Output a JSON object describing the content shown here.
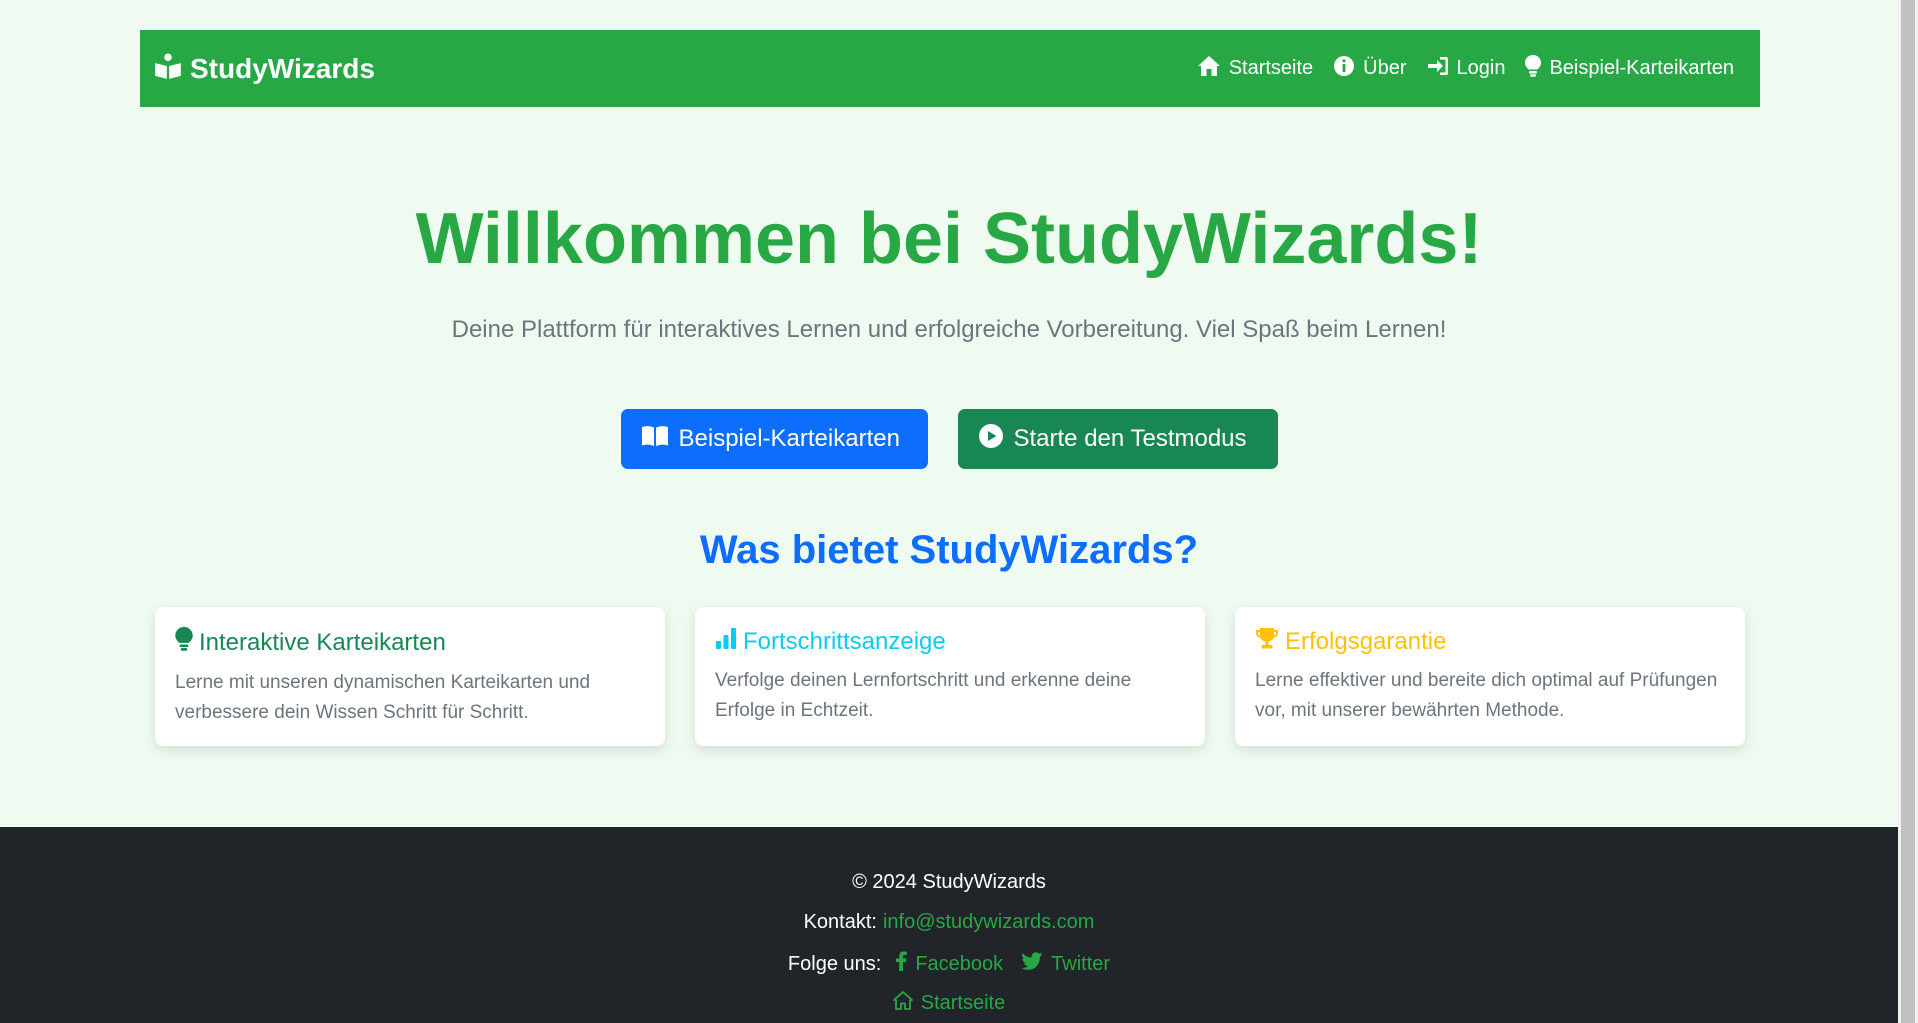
{
  "navbar": {
    "brand": "StudyWizards",
    "brand_icon": "book-reader-icon",
    "links": [
      {
        "label": "Startseite",
        "icon": "home-icon"
      },
      {
        "label": "Über",
        "icon": "info-circle-icon"
      },
      {
        "label": "Login",
        "icon": "sign-in-icon"
      },
      {
        "label": "Beispiel-Karteikarten",
        "icon": "lightbulb-icon"
      }
    ]
  },
  "hero": {
    "title": "Willkommen bei StudyWizards!",
    "subtitle": "Deine Plattform für interaktives Lernen und erfolgreiche Vorbereitung. Viel Spaß beim Lernen!",
    "primary_button": "Beispiel-Karteikarten",
    "secondary_button": "Starte den Testmodus"
  },
  "features": {
    "title": "Was bietet StudyWizards?",
    "cards": [
      {
        "title": "Interaktive Karteikarten",
        "text": "Lerne mit unseren dynamischen Karteikarten und verbessere dein Wissen Schritt für Schritt.",
        "color": "#198754",
        "icon": "lightbulb-icon"
      },
      {
        "title": "Fortschrittsanzeige",
        "text": "Verfolge deinen Lernfortschritt und erkenne deine Erfolge in Echtzeit.",
        "color": "#0dcaf0",
        "icon": "bar-chart-icon"
      },
      {
        "title": "Erfolgsgarantie",
        "text": "Lerne effektiver und bereite dich optimal auf Prüfungen vor, mit unserer bewährten Methode.",
        "color": "#ffc107",
        "icon": "trophy-icon"
      }
    ]
  },
  "footer": {
    "copyright": "© 2024 StudyWizards",
    "contact_label": "Kontakt:",
    "contact_email": "info@studywizards.com",
    "follow_label": "Folge uns:",
    "facebook": "Facebook",
    "twitter": "Twitter",
    "home": "Startseite"
  },
  "colors": {
    "brand_green": "#28a745",
    "primary_blue": "#0d6efd",
    "success_green": "#198754",
    "footer_bg": "#212529",
    "page_bg": "#effbf1"
  }
}
